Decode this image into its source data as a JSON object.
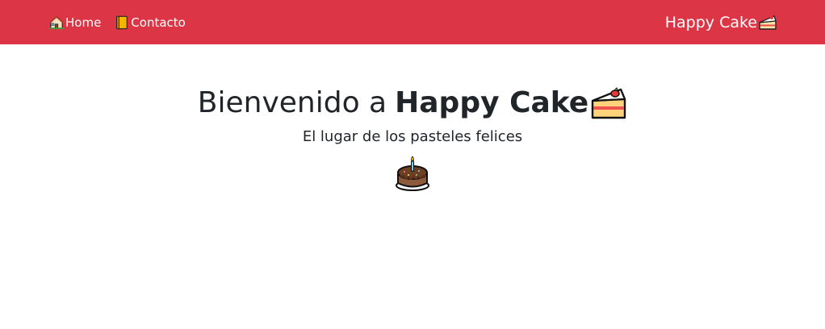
{
  "nav": {
    "home_label": "Home",
    "home_icon": "house-icon",
    "contact_label": "Contacto",
    "contact_icon": "notebook-icon",
    "brand_label": "Happy Cake",
    "brand_icon": "cake-slice-icon"
  },
  "hero": {
    "title_prefix": "Bienvenido a",
    "title_brand": "Happy Cake",
    "title_icon": "cake-slice-icon",
    "subtitle": "El lugar de los pasteles felices",
    "cake_icon": "birthday-cake-icon"
  },
  "colors": {
    "navbar_bg": "#dc3545",
    "nav_text": "#ffffff",
    "body_text": "#212529"
  }
}
